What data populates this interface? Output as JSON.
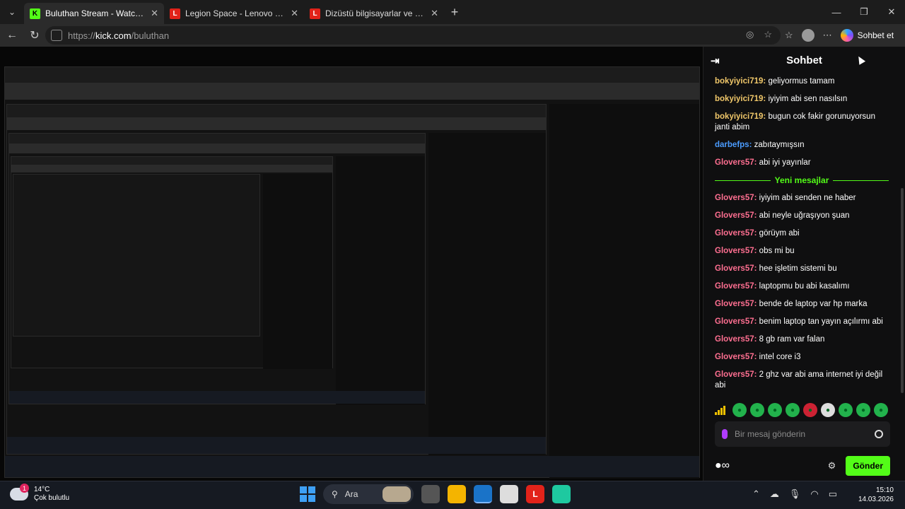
{
  "browser": {
    "tabs": [
      {
        "title": "Buluthan Stream - Watch Live on K",
        "icon": "kick-favicon",
        "active": true
      },
      {
        "title": "Legion Space - Lenovo Support TR",
        "icon": "lenovo-favicon",
        "active": false
      },
      {
        "title": "Dizüstü bilgisayarlar ve masaüstü",
        "icon": "lenovo-favicon",
        "active": false
      }
    ],
    "address": {
      "prefix": "https://",
      "host": "kick.com",
      "path": "/buluthan"
    },
    "copilot_label": "Sohbet et"
  },
  "chat": {
    "title": "Sohbet",
    "messages_before": [
      {
        "user": "bokyiyici719",
        "text": "geliyormus tamam",
        "color": "#f1c86a"
      },
      {
        "user": "bokyiyici719",
        "text": "iyiyim abi sen nasılsın",
        "color": "#f1c86a"
      },
      {
        "user": "bokyiyici719",
        "text": "bugun cok fakir gorunuyorsun janti abim",
        "color": "#f1c86a"
      },
      {
        "user": "darbefps",
        "text": "zabıtaymışsın",
        "color": "#4b9cff"
      },
      {
        "user": "Glovers57",
        "text": "abi iyi yayınlar",
        "color": "#ff6f91"
      }
    ],
    "divider": "Yeni mesajlar",
    "messages_after": [
      {
        "user": "Glovers57",
        "text": "iyiyim abi senden ne haber"
      },
      {
        "user": "Glovers57",
        "text": "abi neyle uğraşıyon şuan"
      },
      {
        "user": "Glovers57",
        "text": "görüym abi"
      },
      {
        "user": "Glovers57",
        "text": "obs mi bu"
      },
      {
        "user": "Glovers57",
        "text": "hee işletim sistemi bu"
      },
      {
        "user": "Glovers57",
        "text": "laptopmu bu abi kasalımı"
      },
      {
        "user": "Glovers57",
        "text": "bende de laptop var hp marka"
      },
      {
        "user": "Glovers57",
        "text": "benim laptop tan yayın açılırmı abi"
      },
      {
        "user": "Glovers57",
        "text": "8 gb ram var falan"
      },
      {
        "user": "Glovers57",
        "text": "intel core i3"
      },
      {
        "user": "Glovers57",
        "text": "2 ghz var abi ama internet iyi değil abi"
      }
    ],
    "input_placeholder": "Bir mesaj gönderin",
    "send_label": "Gönder"
  },
  "taskbar": {
    "weather_temp": "14°C",
    "weather_desc": "Çok bulutlu",
    "notification_count": "1",
    "search_label": "Ara",
    "time": "15:10",
    "date": "14.03.2026"
  }
}
